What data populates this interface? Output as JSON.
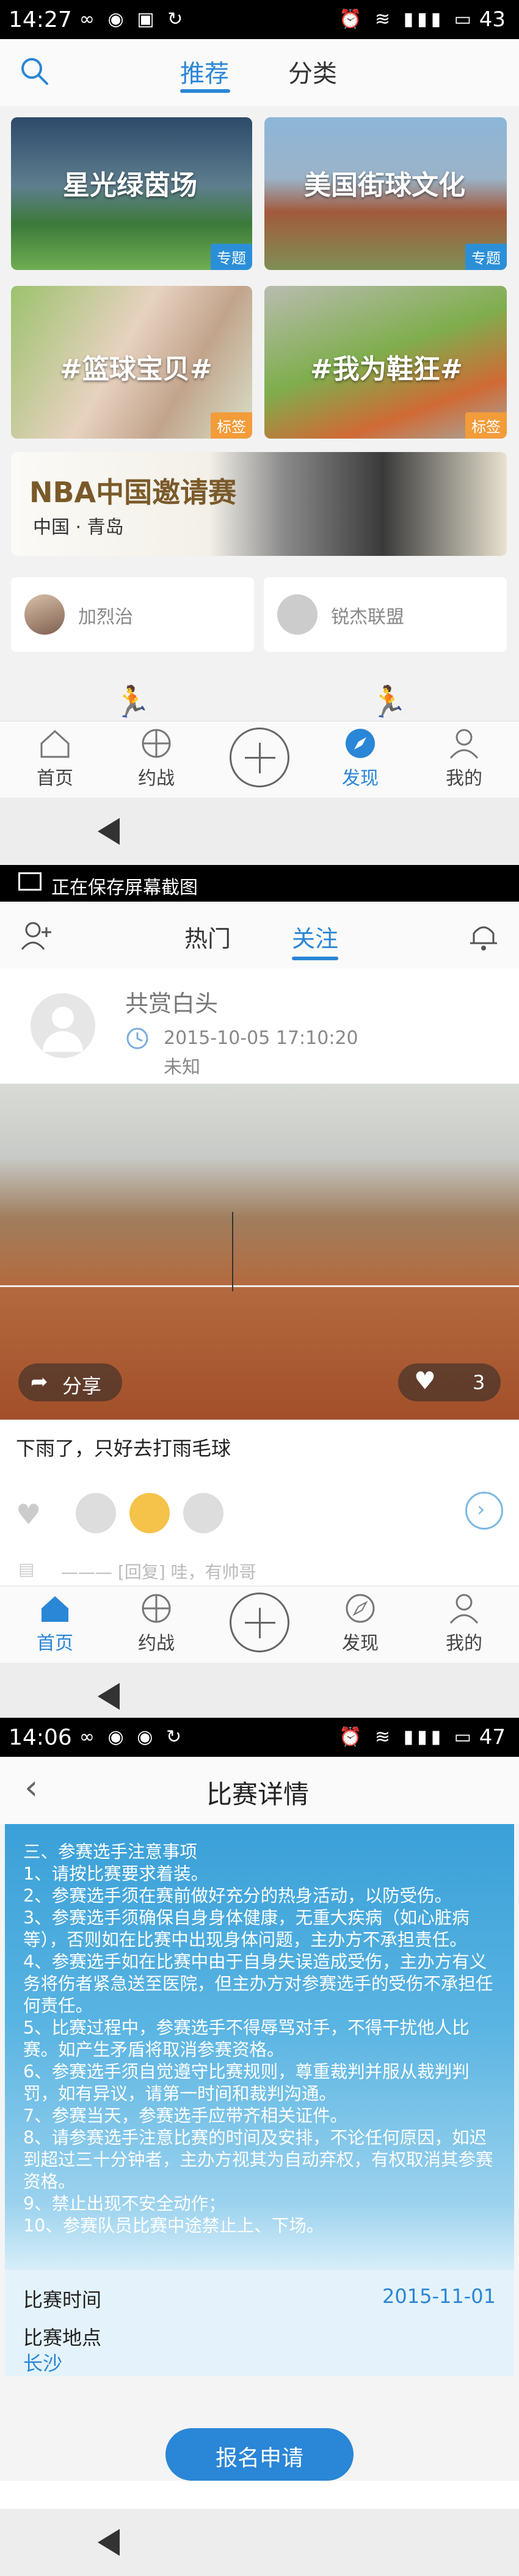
{
  "screen1": {
    "status": {
      "time": "14:27",
      "battery": "43"
    },
    "header": {
      "tab_recommend": "推荐",
      "tab_category": "分类"
    },
    "cards": [
      {
        "title": "星光绿茵场",
        "tag": "专题"
      },
      {
        "title": "美国街球文化",
        "tag": "专题"
      },
      {
        "title": "#篮球宝贝#",
        "tag": "标签"
      },
      {
        "title": "#我为鞋狂#",
        "tag": "标签"
      }
    ],
    "nba_banner": {
      "title": "NBA中国邀请赛",
      "subtitle": "中国 · 青岛"
    },
    "users": [
      {
        "name": "加烈治"
      },
      {
        "name": "锐杰联盟"
      }
    ],
    "bottom_nav": [
      "首页",
      "约战",
      "",
      "发现",
      "我的"
    ]
  },
  "screenshot_toast": {
    "text": "正在保存屏幕截图"
  },
  "screen2": {
    "tabs": {
      "hot": "热门",
      "follow": "关注"
    },
    "post": {
      "author": "共赏白头",
      "datetime": "2015-10-05 17:10:20",
      "location": "未知",
      "share_label": "分享",
      "like_count": "3",
      "caption": "下雨了，只好去打雨毛球",
      "comment_preview": "——— [回复] 哇，有帅哥"
    },
    "bottom_nav": [
      "首页",
      "约战",
      "",
      "发现",
      "我的"
    ]
  },
  "screen3": {
    "status": {
      "time": "14:06",
      "battery": "47"
    },
    "title": "比赛详情",
    "notice_lines": [
      "三、参赛选手注意事项",
      "1、请按比赛要求着装。",
      "2、参赛选手须在赛前做好充分的热身活动，以防受伤。",
      "3、参赛选手须确保自身身体健康，无重大疾病（如心脏病等），否则如在比赛中出现身体问题，主办方不承担责任。",
      "4、参赛选手如在比赛中由于自身失误造成受伤，主办方有义务将伤者紧急送至医院，但主办方对参赛选手的受伤不承担任何责任。",
      "5、比赛过程中，参赛选手不得辱骂对手，不得干扰他人比赛。如产生矛盾将取消参赛资格。",
      "6、参赛选手须自觉遵守比赛规则，尊重裁判并服从裁判判罚，如有异议，请第一时间和裁判沟通。",
      "7、参赛当天，参赛选手应带齐相关证件。",
      "8、请参赛选手注意比赛的时间及安排，不论任何原因，如迟到超过三十分钟者，主办方视其为自动弃权，有权取消其参赛资格。",
      "9、禁止出现不安全动作；",
      "10、参赛队员比赛中途禁止上、下场。"
    ],
    "match_time_label": "比赛时间",
    "match_time_value": "2015-11-01",
    "match_place_label": "比赛地点",
    "match_place_value": "长沙",
    "apply_button": "报名申请"
  }
}
